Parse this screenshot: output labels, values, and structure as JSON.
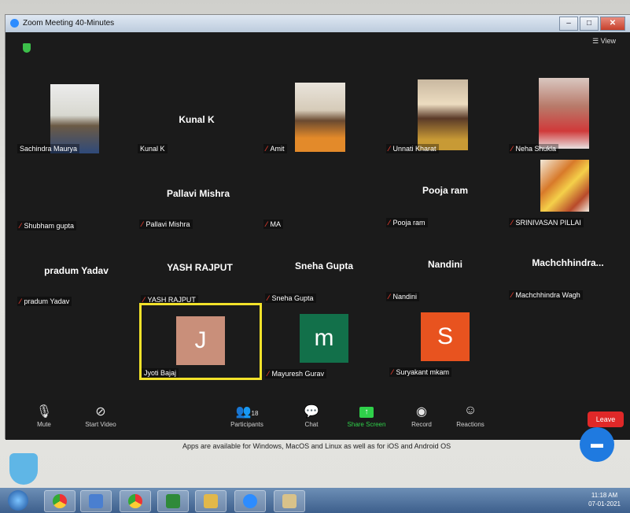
{
  "window": {
    "title": "Zoom Meeting 40-Minutes",
    "view_label": "View"
  },
  "participants": [
    {
      "name": "Sachindra Maurya",
      "center": ""
    },
    {
      "name": "Kunal K",
      "center": "Kunal K"
    },
    {
      "name": "Amit",
      "center": ""
    },
    {
      "name": "Unnati Kharat",
      "center": ""
    },
    {
      "name": "Neha Shukla",
      "center": ""
    },
    {
      "name": "Shubham gupta",
      "center": ""
    },
    {
      "name": "Pallavi Mishra",
      "center": "Pallavi Mishra"
    },
    {
      "name": "MA",
      "center": ""
    },
    {
      "name": "Pooja ram",
      "center": "Pooja ram"
    },
    {
      "name": "SRINIVASAN PILLAI",
      "center": ""
    },
    {
      "name": "pradum Yadav",
      "center": "pradum Yadav"
    },
    {
      "name": "YASH RAJPUT",
      "center": "YASH RAJPUT"
    },
    {
      "name": "Sneha Gupta",
      "center": "Sneha Gupta"
    },
    {
      "name": "Nandini",
      "center": "Nandini"
    },
    {
      "name": "Machchhindra Wagh",
      "center": "Machchhindra..."
    },
    {
      "name": "Jyoti Bajaj",
      "center": ""
    },
    {
      "name": "Mayuresh Gurav",
      "center": ""
    },
    {
      "name": "Suryakant mkam",
      "center": ""
    }
  ],
  "avatars": {
    "jyoti": "J",
    "mayuresh": "m",
    "suryakant": "S"
  },
  "toolbar": {
    "mute": "Mute",
    "start_video": "Start Video",
    "participants": "Participants",
    "participant_count": "18",
    "chat": "Chat",
    "share_screen": "Share Screen",
    "record": "Record",
    "reactions": "Reactions",
    "leave": "Leave"
  },
  "below_text": "Apps are available for Windows, MacOS and Linux as well as for iOS and Android OS",
  "taskbar": {
    "time": "11:18 AM",
    "date": "07-01-2021"
  },
  "colors": {
    "speaker_border": "#f2e22a",
    "share_screen": "#2fd04a",
    "leave": "#e02828",
    "avatar_j": "#c98f7a",
    "avatar_m": "#12704a",
    "avatar_s": "#e8531f"
  }
}
